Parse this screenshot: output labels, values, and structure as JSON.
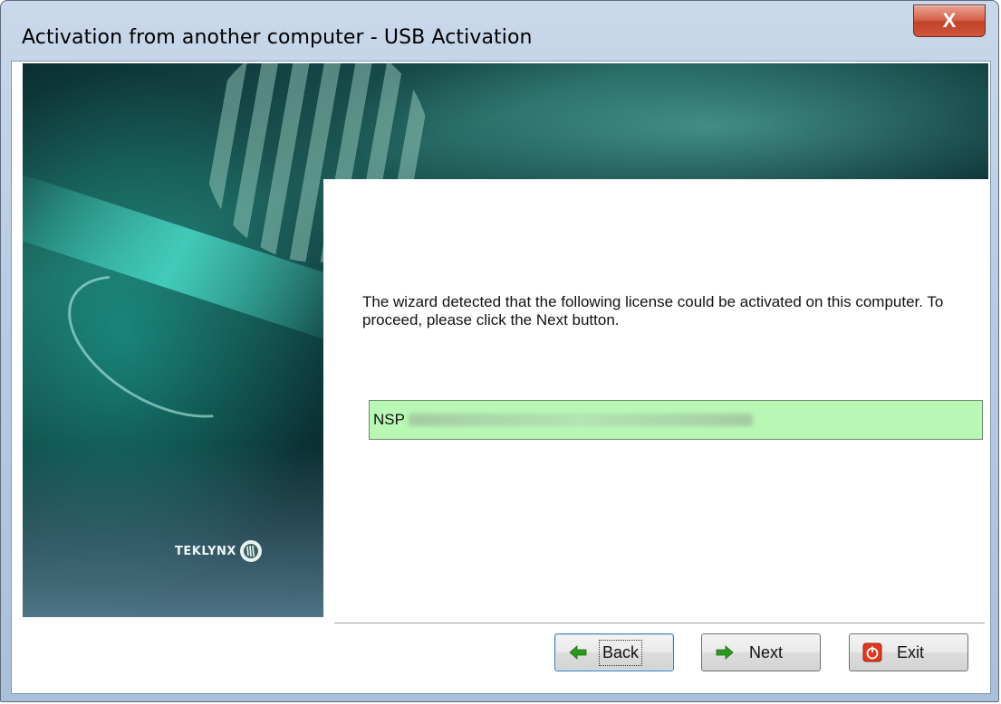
{
  "window": {
    "title": "Activation from another computer - USB Activation",
    "close_glyph": "X"
  },
  "banner": {
    "brand": "TEKLYNX"
  },
  "content": {
    "message": "The wizard detected that the following license could be activated on this computer. To proceed, please click the Next button.",
    "license_prefix": "NSP",
    "license_value_visible": false
  },
  "buttons": {
    "back_label": "Back",
    "next_label": "Next",
    "exit_label": "Exit"
  },
  "icons": {
    "back": "arrow-left-icon",
    "next": "arrow-right-icon",
    "exit": "power-icon",
    "close": "close-icon"
  },
  "colors": {
    "license_bg": "#b8f7b4",
    "arrow_green": "#2a9a1c",
    "exit_red": "#e0381f",
    "close_red": "#c7472e"
  }
}
